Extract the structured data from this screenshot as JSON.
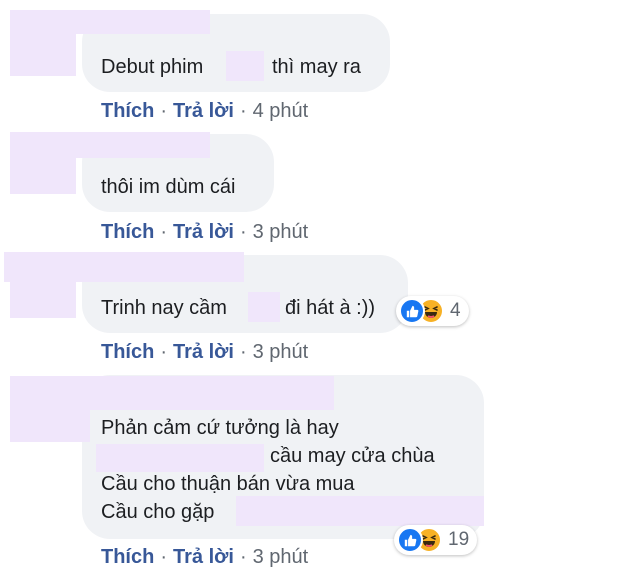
{
  "colors": {
    "bubble": "#f0f2f5",
    "redaction": "#f0e6fb",
    "link": "#385898",
    "like_blue": "#1877f2",
    "haha_yellow": "#f7b125"
  },
  "actions": {
    "like_label": "Thích",
    "separator": "·",
    "reply_label": "Trả lời"
  },
  "comments": [
    {
      "lines": [
        {
          "before": "Debut phim",
          "after": "thì may ra"
        }
      ],
      "time": "4 phút"
    },
    {
      "lines": [
        {
          "before": "thôi im dùm cái"
        }
      ],
      "time": "3 phút"
    },
    {
      "lines": [
        {
          "before": "Trinh nay cầm",
          "after": "đi hát à :))"
        }
      ],
      "reactions": {
        "icons": [
          "like-icon",
          "haha-icon"
        ],
        "count": "4"
      },
      "time": "3 phút"
    },
    {
      "lines": [
        {
          "before": "Phản cảm cứ tưởng là hay"
        },
        {
          "after": "cầu may cửa chùa"
        },
        {
          "before": "Cầu cho thuận bán vừa mua"
        },
        {
          "before": "Cầu cho gặp"
        }
      ],
      "reactions": {
        "icons": [
          "like-icon",
          "haha-icon"
        ],
        "count": "19"
      },
      "time": "3 phút"
    }
  ]
}
